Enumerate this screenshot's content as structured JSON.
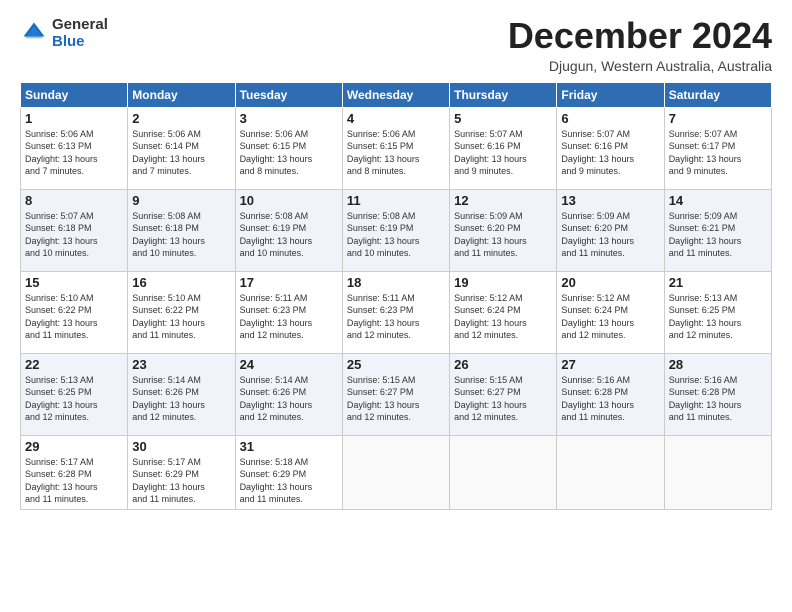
{
  "header": {
    "logo_general": "General",
    "logo_blue": "Blue",
    "month_title": "December 2024",
    "location": "Djugun, Western Australia, Australia"
  },
  "weekdays": [
    "Sunday",
    "Monday",
    "Tuesday",
    "Wednesday",
    "Thursday",
    "Friday",
    "Saturday"
  ],
  "weeks": [
    [
      {
        "day": "1",
        "sunrise": "5:06 AM",
        "sunset": "6:13 PM",
        "daylight": "13 hours and 7 minutes."
      },
      {
        "day": "2",
        "sunrise": "5:06 AM",
        "sunset": "6:14 PM",
        "daylight": "13 hours and 7 minutes."
      },
      {
        "day": "3",
        "sunrise": "5:06 AM",
        "sunset": "6:15 PM",
        "daylight": "13 hours and 8 minutes."
      },
      {
        "day": "4",
        "sunrise": "5:06 AM",
        "sunset": "6:15 PM",
        "daylight": "13 hours and 8 minutes."
      },
      {
        "day": "5",
        "sunrise": "5:07 AM",
        "sunset": "6:16 PM",
        "daylight": "13 hours and 9 minutes."
      },
      {
        "day": "6",
        "sunrise": "5:07 AM",
        "sunset": "6:16 PM",
        "daylight": "13 hours and 9 minutes."
      },
      {
        "day": "7",
        "sunrise": "5:07 AM",
        "sunset": "6:17 PM",
        "daylight": "13 hours and 9 minutes."
      }
    ],
    [
      {
        "day": "8",
        "sunrise": "5:07 AM",
        "sunset": "6:18 PM",
        "daylight": "13 hours and 10 minutes."
      },
      {
        "day": "9",
        "sunrise": "5:08 AM",
        "sunset": "6:18 PM",
        "daylight": "13 hours and 10 minutes."
      },
      {
        "day": "10",
        "sunrise": "5:08 AM",
        "sunset": "6:19 PM",
        "daylight": "13 hours and 10 minutes."
      },
      {
        "day": "11",
        "sunrise": "5:08 AM",
        "sunset": "6:19 PM",
        "daylight": "13 hours and 10 minutes."
      },
      {
        "day": "12",
        "sunrise": "5:09 AM",
        "sunset": "6:20 PM",
        "daylight": "13 hours and 11 minutes."
      },
      {
        "day": "13",
        "sunrise": "5:09 AM",
        "sunset": "6:20 PM",
        "daylight": "13 hours and 11 minutes."
      },
      {
        "day": "14",
        "sunrise": "5:09 AM",
        "sunset": "6:21 PM",
        "daylight": "13 hours and 11 minutes."
      }
    ],
    [
      {
        "day": "15",
        "sunrise": "5:10 AM",
        "sunset": "6:22 PM",
        "daylight": "13 hours and 11 minutes."
      },
      {
        "day": "16",
        "sunrise": "5:10 AM",
        "sunset": "6:22 PM",
        "daylight": "13 hours and 11 minutes."
      },
      {
        "day": "17",
        "sunrise": "5:11 AM",
        "sunset": "6:23 PM",
        "daylight": "13 hours and 12 minutes."
      },
      {
        "day": "18",
        "sunrise": "5:11 AM",
        "sunset": "6:23 PM",
        "daylight": "13 hours and 12 minutes."
      },
      {
        "day": "19",
        "sunrise": "5:12 AM",
        "sunset": "6:24 PM",
        "daylight": "13 hours and 12 minutes."
      },
      {
        "day": "20",
        "sunrise": "5:12 AM",
        "sunset": "6:24 PM",
        "daylight": "13 hours and 12 minutes."
      },
      {
        "day": "21",
        "sunrise": "5:13 AM",
        "sunset": "6:25 PM",
        "daylight": "13 hours and 12 minutes."
      }
    ],
    [
      {
        "day": "22",
        "sunrise": "5:13 AM",
        "sunset": "6:25 PM",
        "daylight": "13 hours and 12 minutes."
      },
      {
        "day": "23",
        "sunrise": "5:14 AM",
        "sunset": "6:26 PM",
        "daylight": "13 hours and 12 minutes."
      },
      {
        "day": "24",
        "sunrise": "5:14 AM",
        "sunset": "6:26 PM",
        "daylight": "13 hours and 12 minutes."
      },
      {
        "day": "25",
        "sunrise": "5:15 AM",
        "sunset": "6:27 PM",
        "daylight": "13 hours and 12 minutes."
      },
      {
        "day": "26",
        "sunrise": "5:15 AM",
        "sunset": "6:27 PM",
        "daylight": "13 hours and 12 minutes."
      },
      {
        "day": "27",
        "sunrise": "5:16 AM",
        "sunset": "6:28 PM",
        "daylight": "13 hours and 11 minutes."
      },
      {
        "day": "28",
        "sunrise": "5:16 AM",
        "sunset": "6:28 PM",
        "daylight": "13 hours and 11 minutes."
      }
    ],
    [
      {
        "day": "29",
        "sunrise": "5:17 AM",
        "sunset": "6:28 PM",
        "daylight": "13 hours and 11 minutes."
      },
      {
        "day": "30",
        "sunrise": "5:17 AM",
        "sunset": "6:29 PM",
        "daylight": "13 hours and 11 minutes."
      },
      {
        "day": "31",
        "sunrise": "5:18 AM",
        "sunset": "6:29 PM",
        "daylight": "13 hours and 11 minutes."
      },
      null,
      null,
      null,
      null
    ]
  ],
  "labels": {
    "sunrise": "Sunrise:",
    "sunset": "Sunset:",
    "daylight": "Daylight:"
  }
}
